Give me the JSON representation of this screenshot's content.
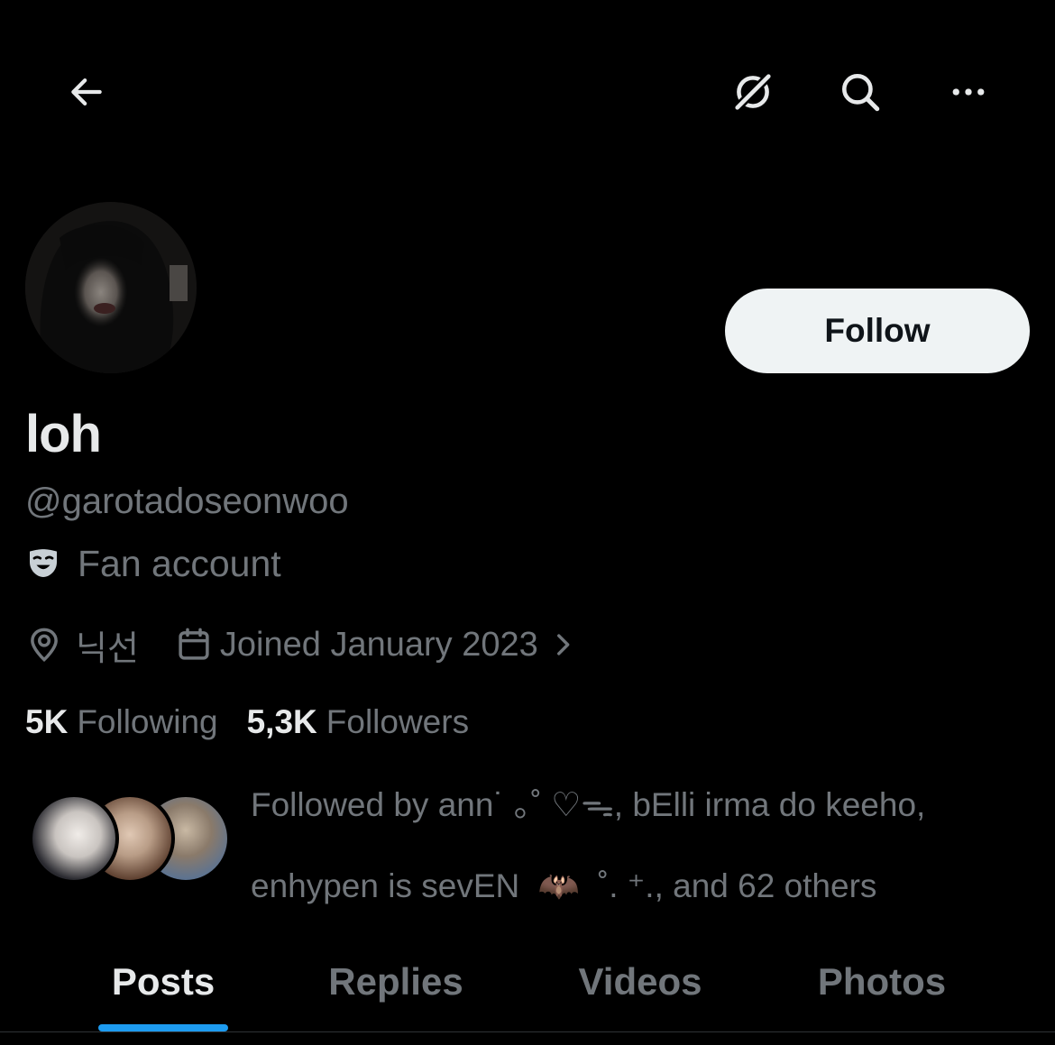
{
  "header": {
    "back_icon": "arrow-left-icon",
    "grok_icon": "grok-icon",
    "search_icon": "search-icon",
    "more_icon": "more-horizontal-icon"
  },
  "profile": {
    "display_name": "loh",
    "handle": "@garotadoseonwoo",
    "category_icon": "theater-mask-icon",
    "category": "Fan account",
    "location_icon": "location-pin-icon",
    "location": "닉선",
    "joined_icon": "calendar-icon",
    "joined": "Joined January 2023",
    "joined_chevron_icon": "chevron-right-icon",
    "follow_label": "Follow"
  },
  "stats": {
    "following_count": "5K",
    "following_label": "Following",
    "followers_count": "5,3K",
    "followers_label": "Followers"
  },
  "followed_by": {
    "line1": "Followed by ann˙ ｡˚ ♡ᯓ, bElli irma do keeho,",
    "line2_text": "enhypen is sevEN",
    "line2_emoji": "🦇",
    "line2_suffix": "˚. ⁺., and 62 others"
  },
  "tabs": [
    {
      "label": "Posts",
      "active": true
    },
    {
      "label": "Replies",
      "active": false
    },
    {
      "label": "Videos",
      "active": false
    },
    {
      "label": "Photos",
      "active": false
    }
  ],
  "colors": {
    "background": "#000000",
    "primary_text": "#e7e9ea",
    "secondary_text": "#71767b",
    "accent": "#1d9bf0",
    "follow_button_bg": "#eff3f4"
  }
}
